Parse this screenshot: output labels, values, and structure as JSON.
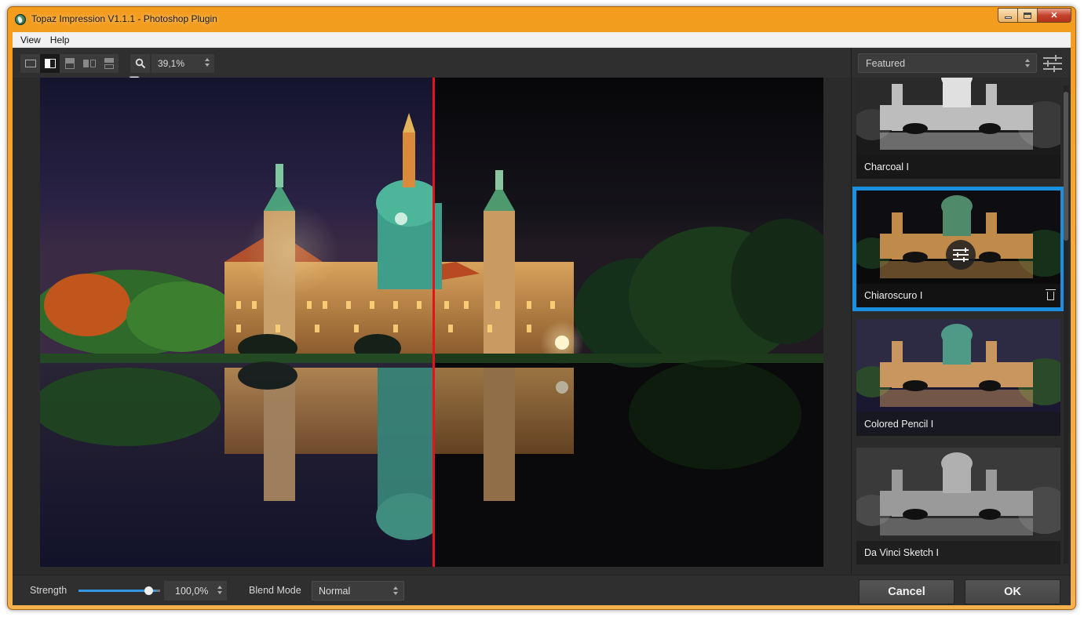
{
  "window": {
    "title": "Topaz Impression V1.1.1 - Photoshop Plugin",
    "controls": [
      "minimize-icon",
      "maximize-icon",
      "close-icon"
    ],
    "close_glyph": "✕"
  },
  "menu": {
    "items": [
      "View",
      "Help"
    ]
  },
  "toolbar": {
    "view_modes": [
      "single-view-icon",
      "split-view-icon",
      "split-horizontal-icon",
      "side-by-side-icon",
      "stacked-view-icon"
    ],
    "active_view_mode": "split-view-icon",
    "zoom": {
      "icon": "zoom-icon",
      "value": "39,1%",
      "slider_fraction": 0.0
    }
  },
  "preview": {
    "description_icons": [],
    "split_line_color": "#e8131a"
  },
  "sidebar": {
    "category": "Featured",
    "settings_icon": "sliders-icon",
    "presets": [
      {
        "label": "Charcoal I",
        "style": "charcoal",
        "selected": false
      },
      {
        "label": "Chiaroscuro I",
        "style": "chiaroscuro",
        "selected": true
      },
      {
        "label": "Colored Pencil I",
        "style": "pencil",
        "selected": false
      },
      {
        "label": "Da Vinci Sketch I",
        "style": "sketch",
        "selected": false
      }
    ],
    "selection_color": "#1b8fe0"
  },
  "bottom": {
    "strength_label": "Strength",
    "strength_value": "100,0%",
    "strength_fraction": 1.0,
    "blend_label": "Blend Mode",
    "blend_value": "Normal",
    "cancel_label": "Cancel",
    "ok_label": "OK",
    "accent": "#3399e6"
  }
}
